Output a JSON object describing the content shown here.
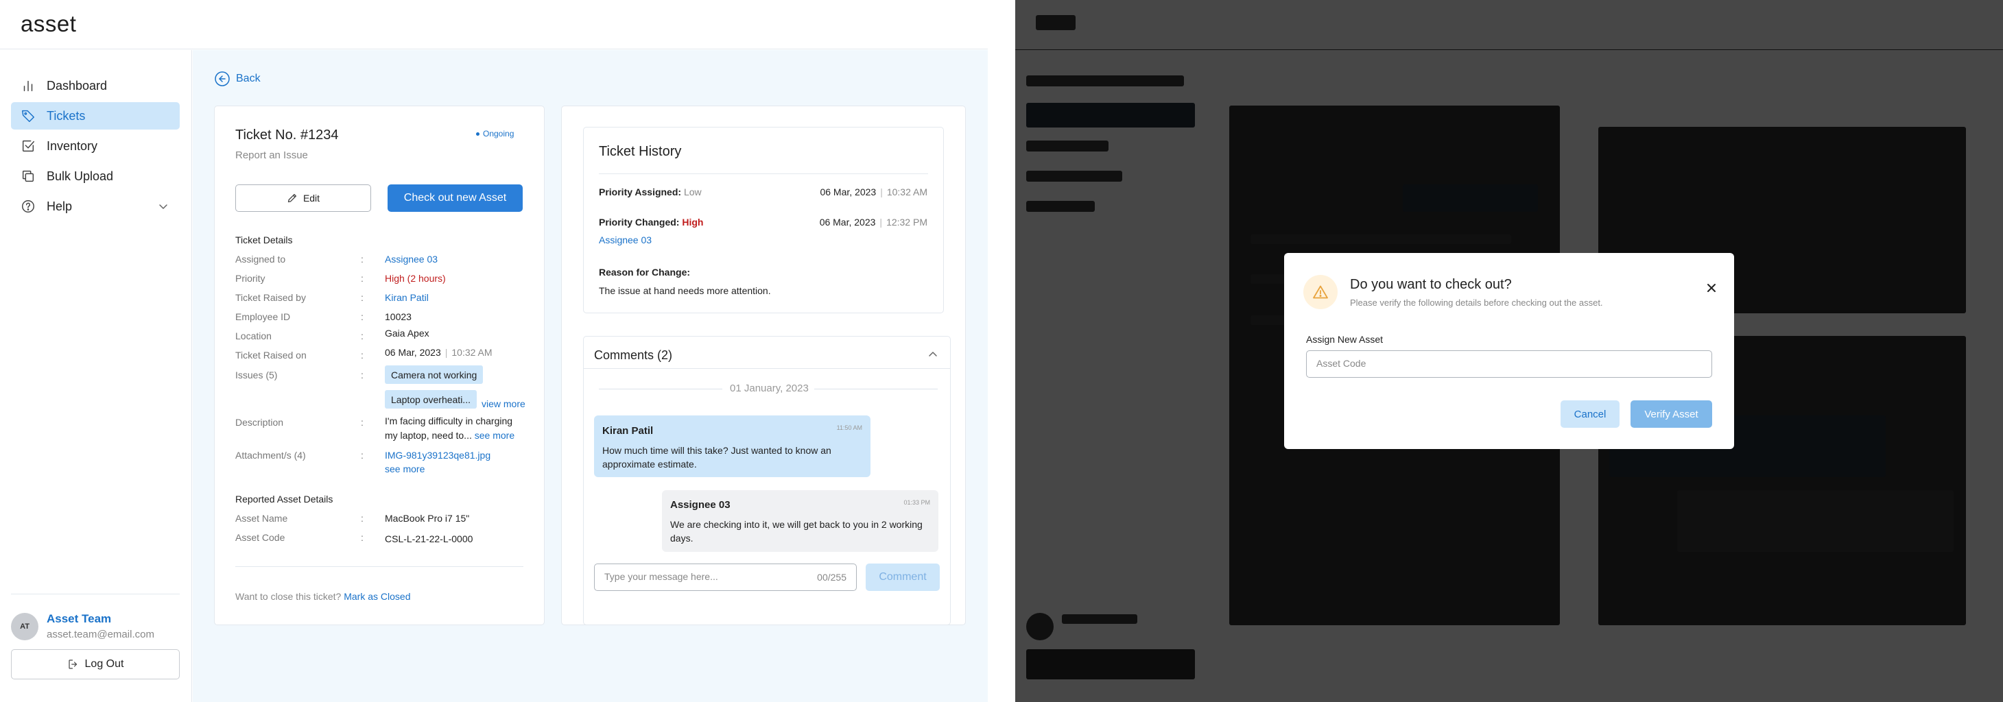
{
  "app": {
    "logo": "asset"
  },
  "sidebar": {
    "items": [
      {
        "label": "Dashboard",
        "icon": "bar-chart-icon",
        "active": false
      },
      {
        "label": "Tickets",
        "icon": "tag-icon",
        "active": true
      },
      {
        "label": "Inventory",
        "icon": "checkbox-icon",
        "active": false
      },
      {
        "label": "Bulk Upload",
        "icon": "copy-icon",
        "active": false
      },
      {
        "label": "Help",
        "icon": "help-circle-icon",
        "active": false
      }
    ],
    "user": {
      "initials": "AT",
      "name": "Asset Team",
      "email": "asset.team@email.com"
    },
    "logout_label": "Log Out"
  },
  "main": {
    "back_label": "Back",
    "ticket": {
      "title": "Ticket No. #1234",
      "subtitle": "Report an Issue",
      "status": "Ongoing",
      "edit_label": "Edit",
      "checkout_label": "Check out new Asset",
      "details_title": "Ticket Details",
      "details": [
        {
          "label": "Assigned to",
          "value": "Assignee 03"
        },
        {
          "label": "Priority",
          "value": "High (2 hours)"
        },
        {
          "label": "Ticket Raised by",
          "value": "Kiran Patil"
        },
        {
          "label": "Employee ID",
          "value": "10023"
        },
        {
          "label": "Location",
          "value": "Gaia Apex"
        },
        {
          "label": "Ticket Raised on",
          "value": "06 Mar, 2023",
          "time": "10:32 AM"
        }
      ],
      "issues_label": "Issues (5)",
      "issues": [
        "Camera not working",
        "Laptop overheati..."
      ],
      "view_more": "view more",
      "description_label": "Description",
      "description_line1": "I'm facing difficulty in charging",
      "description_line2": "my laptop, need to...",
      "see_more": "see more",
      "attachments_label": "Attachment/s (4)",
      "attachment_file": "IMG-981y39123qe81.jpg",
      "attachment_see_more": "see more",
      "asset_section_title": "Reported Asset Details",
      "asset_details": [
        {
          "label": "Asset Name",
          "value": "MacBook Pro i7 15\""
        },
        {
          "label": "Asset Code",
          "value": "CSL-L-21-22-L-0000"
        }
      ],
      "close_prompt": "Want to close this ticket?",
      "close_link": "Mark as Closed"
    },
    "history": {
      "title": "Ticket History",
      "entries": [
        {
          "label": "Priority Assigned:",
          "value": "Low",
          "date": "06 Mar, 2023",
          "time": "10:32 AM"
        },
        {
          "label": "Priority Changed:",
          "value": "High",
          "date": "06 Mar, 2023",
          "time": "12:32 PM",
          "assignee": "Assignee 03"
        }
      ],
      "reason_label": "Reason for Change:",
      "reason_text": "The issue at hand needs more attention."
    },
    "comments": {
      "title": "Comments (2)",
      "date_divider": "01 January, 2023",
      "messages": [
        {
          "author": "Kiran Patil",
          "time": "11:50 AM",
          "line1": "How much time will this take? Just wanted to know an",
          "line2": "approximate estimate."
        },
        {
          "author": "Assignee 03",
          "time": "01:33 PM",
          "line1": "We are checking into it, we will get back to you in 2 working",
          "line2": "days."
        }
      ],
      "input_placeholder": "Type your message here...",
      "char_count": "00/255",
      "comment_label": "Comment"
    }
  },
  "modal": {
    "title": "Do you want to check out?",
    "subtitle": "Please verify the following details before checking out the asset.",
    "field_label": "Assign New Asset",
    "field_placeholder": "Asset Code",
    "cancel_label": "Cancel",
    "verify_label": "Verify Asset"
  },
  "colors": {
    "accent": "#2b7fd9",
    "accent_light": "#cde6fa",
    "link": "#1a72c9",
    "danger": "#c01d1d",
    "page_bg": "#f1f8fd",
    "warning_bg": "#fff2dc",
    "warning": "#e8a33d"
  }
}
